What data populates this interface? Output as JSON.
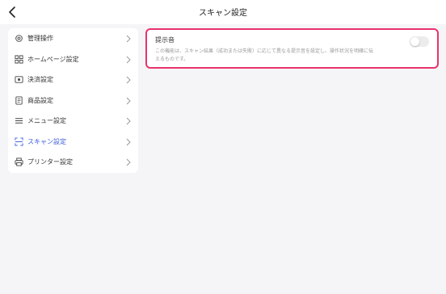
{
  "header": {
    "title": "スキャン設定",
    "back_icon": "chevron-left-icon"
  },
  "sidebar": {
    "items": [
      {
        "label": "管理操作",
        "icon": "gear-icon",
        "active": false
      },
      {
        "label": "ホームページ設定",
        "icon": "grid-icon",
        "active": false
      },
      {
        "label": "決済設定",
        "icon": "payment-icon",
        "active": false
      },
      {
        "label": "商品設定",
        "icon": "document-icon",
        "active": false
      },
      {
        "label": "メニュー設定",
        "icon": "menu-icon",
        "active": false
      },
      {
        "label": "スキャン設定",
        "icon": "scan-icon",
        "active": true
      },
      {
        "label": "プリンター設定",
        "icon": "printer-icon",
        "active": false
      }
    ]
  },
  "setting": {
    "title": "提示音",
    "description": "この機能は、スキャン結果（成功または失敗）に応じて異なる提示音を設定し、操作状況を明確に伝えるものです。",
    "enabled": false
  },
  "colors": {
    "accent": "#3b5bdb",
    "highlight": "#e8336d",
    "background": "#f5f5f7"
  }
}
